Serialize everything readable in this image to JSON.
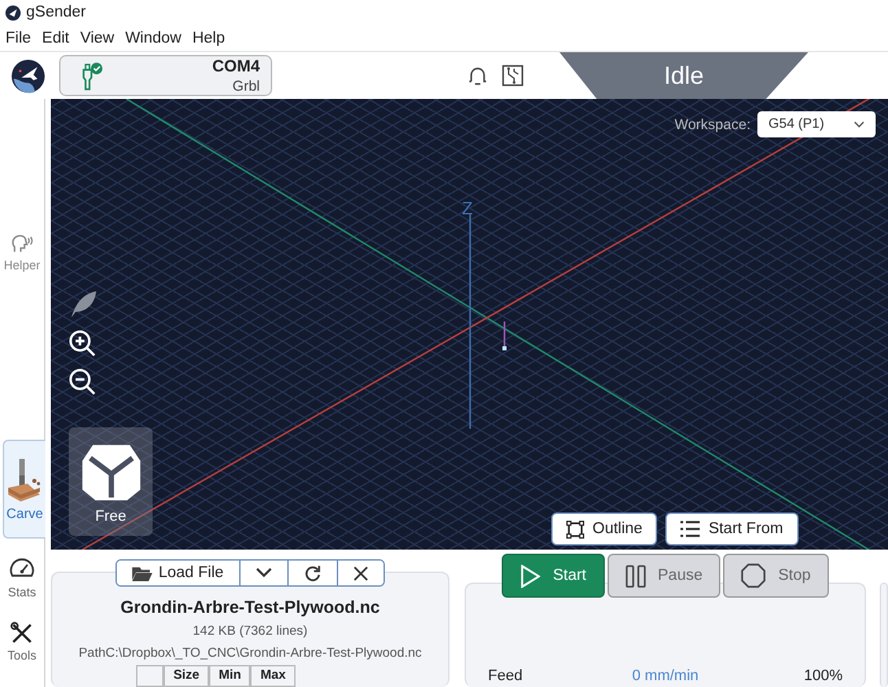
{
  "app": {
    "title": "gSender"
  },
  "menu": [
    "File",
    "Edit",
    "View",
    "Window",
    "Help"
  ],
  "connection": {
    "port": "COM4",
    "firmware": "Grbl",
    "connected": true
  },
  "status": {
    "label": "Idle"
  },
  "sidebar": [
    {
      "label": "Helper",
      "selected": false,
      "kind": "helper"
    },
    {
      "label": "Carve",
      "selected": true,
      "kind": "carve"
    },
    {
      "label": "Stats",
      "selected": false,
      "kind": "stats"
    },
    {
      "label": "Tools",
      "selected": false,
      "kind": "tools"
    }
  ],
  "visualizer": {
    "axis_label": "Z",
    "workspace_label": "Workspace:",
    "workspace": "G54 (P1)",
    "camera_mode": "Free",
    "actions": [
      {
        "label": "Outline",
        "kind": "outline"
      },
      {
        "label": "Start From",
        "kind": "start-from"
      }
    ]
  },
  "file_toolbar": [
    {
      "kind": "load",
      "label": "Load File"
    },
    {
      "kind": "dropdown"
    },
    {
      "kind": "reload"
    },
    {
      "kind": "close"
    }
  ],
  "file_info": {
    "name": "Grondin-Arbre-Test-Plywood.nc",
    "size": "142 KB (7362 lines)",
    "path": "PathC:\\Dropbox\\_TO_CNC\\Grondin-Arbre-Test-Plywood.nc",
    "columns": [
      "Size",
      "Min",
      "Max"
    ]
  },
  "job_controls": [
    {
      "kind": "start",
      "label": "Start",
      "disabled": false
    },
    {
      "kind": "pause",
      "label": "Pause",
      "disabled": true
    },
    {
      "kind": "stop",
      "label": "Stop",
      "disabled": true
    }
  ],
  "overrides": [
    {
      "label": "Feed",
      "value": "0 mm/min",
      "percent": "100%"
    }
  ]
}
